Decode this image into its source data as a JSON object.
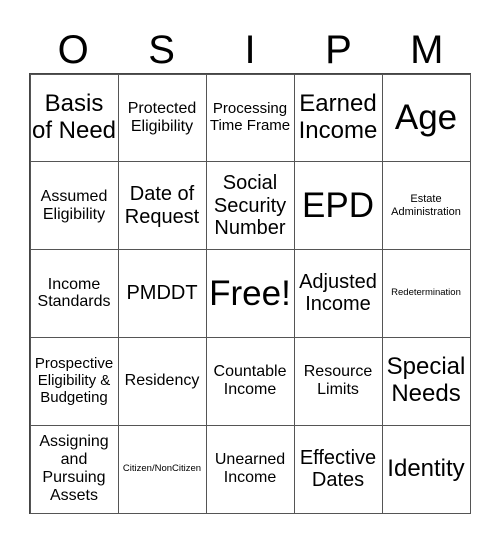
{
  "header": {
    "letters": [
      "O",
      "S",
      "I",
      "P",
      "M"
    ]
  },
  "card": {
    "rows": [
      [
        {
          "text": "Basis of Need",
          "size": "lg"
        },
        {
          "text": "Protected Eligibility",
          "size": "sm"
        },
        {
          "text": "Processing Time Frame",
          "size": "xs"
        },
        {
          "text": "Earned Income",
          "size": "lg"
        },
        {
          "text": "Age",
          "size": "xl"
        }
      ],
      [
        {
          "text": "Assumed Eligibility",
          "size": "sm"
        },
        {
          "text": "Date of Request",
          "size": "md"
        },
        {
          "text": "Social Security Number",
          "size": "md"
        },
        {
          "text": "EPD",
          "size": "xl"
        },
        {
          "text": "Estate Administration",
          "size": "xxs"
        }
      ],
      [
        {
          "text": "Income Standards",
          "size": "sm"
        },
        {
          "text": "PMDDT",
          "size": "md"
        },
        {
          "text": "Free!",
          "size": "xl"
        },
        {
          "text": "Adjusted Income",
          "size": "md"
        },
        {
          "text": "Redetermination",
          "size": "tiny"
        }
      ],
      [
        {
          "text": "Prospective Eligibility & Budgeting",
          "size": "xs"
        },
        {
          "text": "Residency",
          "size": "sm"
        },
        {
          "text": "Countable Income",
          "size": "sm"
        },
        {
          "text": "Resource Limits",
          "size": "sm"
        },
        {
          "text": "Special Needs",
          "size": "lg"
        }
      ],
      [
        {
          "text": "Assigning and Pursuing Assets",
          "size": "sm"
        },
        {
          "text": "Citizen/NonCitizen",
          "size": "tiny"
        },
        {
          "text": "Unearned Income",
          "size": "sm"
        },
        {
          "text": "Effective Dates",
          "size": "md"
        },
        {
          "text": "Identity",
          "size": "lg"
        }
      ]
    ]
  }
}
